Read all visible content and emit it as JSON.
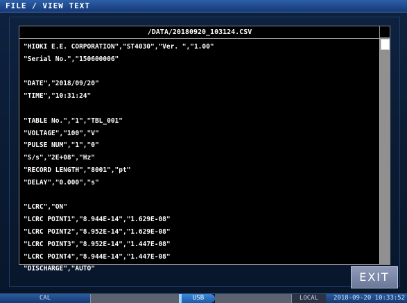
{
  "window": {
    "title": "FILE / VIEW TEXT"
  },
  "viewer": {
    "filename": "/DATA/20180920_103124.CSV",
    "lines": [
      "\"HIOKI E.E. CORPORATION\",\"ST4030\",\"Ver. \",\"1.00\"",
      "\"Serial No.\",\"150600006\"",
      "",
      "\"DATE\",\"2018/09/20\"",
      "\"TIME\",\"10:31:24\"",
      "",
      "\"TABLE No.\",\"1\",\"TBL_001\"",
      "\"VOLTAGE\",\"100\",\"V\"",
      "\"PULSE NUM\",\"1\",\"0\"",
      "\"S/s\",\"2E+08\",\"Hz\"",
      "\"RECORD LENGTH\",\"8001\",\"pt\"",
      "\"DELAY\",\"0.000\",\"s\"",
      "",
      "\"LCRC\",\"ON\"",
      "\"LCRC POINT1\",\"8.944E-14\",\"1.629E-08\"",
      "\"LCRC POINT2\",\"8.952E-14\",\"1.629E-08\"",
      "\"LCRC POINT3\",\"8.952E-14\",\"1.447E-08\"",
      "\"LCRC POINT4\",\"8.944E-14\",\"1.447E-08\"",
      "\"DISCHARGE\",\"AUTO\""
    ]
  },
  "buttons": {
    "exit_label": "EXIT"
  },
  "status": {
    "cal": "CAL",
    "usb": "USB",
    "mode": "LOCAL",
    "datetime": "2018-09-20 10:33:52"
  }
}
